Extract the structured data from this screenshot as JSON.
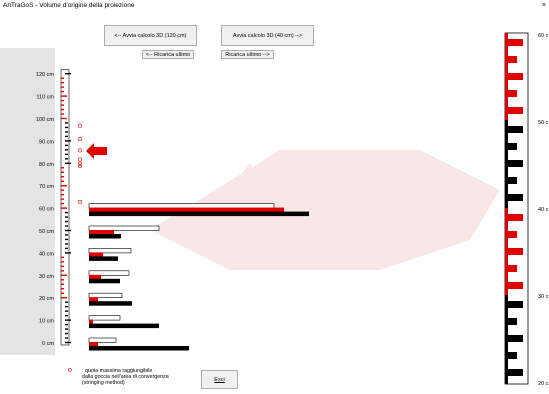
{
  "window": {
    "title": "AnTraGoS - Volume d'origine della proiezione",
    "close_glyph": "×"
  },
  "toolbar": {
    "prev_calc_label": "<-- Avvia calcolo 3D (120 cm)",
    "next_calc_label": "Avvia calcolo 3D (40 cm) -->",
    "reload_prev_label": "<-- Ricarica ultimo",
    "reload_next_label": "Ricarica ultimo -->"
  },
  "axis": {
    "tick_labels": [
      "120 cm",
      "110 cm",
      "100 cm",
      "90 cm",
      "80 cm",
      "70 cm",
      "60 cm",
      "50 cm",
      "40 cm",
      "30 cm",
      "20 cm",
      "10 cm",
      "0 cm"
    ]
  },
  "legend": {
    "marker": "o",
    "text_lines": [
      ": quota massima raggiungibile",
      "dalla goccia nell'area di convergenza",
      "(stringing method)"
    ]
  },
  "footer": {
    "exit_label": "Esci"
  },
  "right_ruler": {
    "labels": [
      "60 c",
      "50 c",
      "40 c",
      "30 c",
      "20 c"
    ]
  },
  "colors": {
    "accent_red": "#e00000",
    "black": "#000000",
    "panel_gray": "#e4e4e4"
  },
  "chart_data": {
    "type": "bar",
    "orientation": "horizontal",
    "categories": [
      "0 cm",
      "10 cm",
      "20 cm",
      "30 cm",
      "40 cm",
      "50 cm",
      "60 cm"
    ],
    "series": [
      {
        "values": [
          27,
          31,
          33,
          40,
          42,
          70,
          185
        ]
      },
      {
        "values": [
          9,
          4,
          9,
          12,
          14,
          25,
          195
        ]
      },
      {
        "values": [
          100,
          70,
          43,
          31,
          29,
          32,
          220
        ]
      }
    ],
    "circle_markers_y_cm": [
      63,
      79,
      80,
      82,
      86,
      91,
      97
    ],
    "arrow_y_cm": 83
  }
}
